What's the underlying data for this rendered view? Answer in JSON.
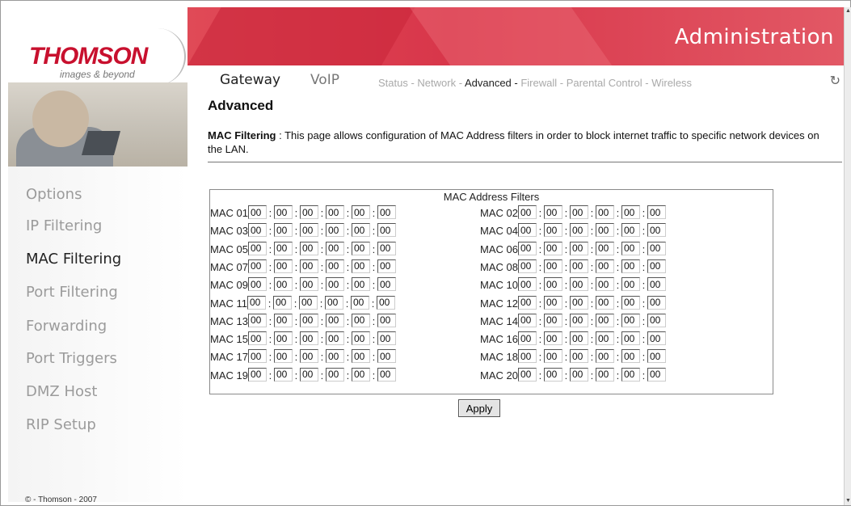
{
  "brand": {
    "name": "THOMSON",
    "tagline": "images & beyond"
  },
  "header": {
    "title": "Administration"
  },
  "tabs": [
    {
      "label": "Gateway",
      "active": true
    },
    {
      "label": "VoIP",
      "active": false
    }
  ],
  "subnav": [
    {
      "label": "Status",
      "active": false
    },
    {
      "label": "Network",
      "active": false
    },
    {
      "label": "Advanced",
      "active": true
    },
    {
      "label": "Firewall",
      "active": false
    },
    {
      "label": "Parental Control",
      "active": false
    },
    {
      "label": "Wireless",
      "active": false
    }
  ],
  "sidebar": {
    "items": [
      {
        "label": "Options",
        "active": false
      },
      {
        "label": "IP Filtering",
        "active": false
      },
      {
        "label": "MAC Filtering",
        "active": true
      },
      {
        "label": "Port Filtering",
        "active": false
      },
      {
        "label": "Forwarding",
        "active": false
      },
      {
        "label": "Port Triggers",
        "active": false
      },
      {
        "label": "DMZ Host",
        "active": false
      },
      {
        "label": "RIP Setup",
        "active": false
      }
    ],
    "copyright": "© - Thomson - 2007"
  },
  "page": {
    "title": "Advanced",
    "desc_strong": "MAC Filtering",
    "desc_text": " :  This page allows configuration of MAC Address filters in order to block internet traffic to specific network devices on the LAN."
  },
  "filters": {
    "caption": "MAC Address Filters",
    "entries": [
      {
        "label": "MAC 01",
        "octets": [
          "00",
          "00",
          "00",
          "00",
          "00",
          "00"
        ]
      },
      {
        "label": "MAC 02",
        "octets": [
          "00",
          "00",
          "00",
          "00",
          "00",
          "00"
        ]
      },
      {
        "label": "MAC 03",
        "octets": [
          "00",
          "00",
          "00",
          "00",
          "00",
          "00"
        ]
      },
      {
        "label": "MAC 04",
        "octets": [
          "00",
          "00",
          "00",
          "00",
          "00",
          "00"
        ]
      },
      {
        "label": "MAC 05",
        "octets": [
          "00",
          "00",
          "00",
          "00",
          "00",
          "00"
        ]
      },
      {
        "label": "MAC 06",
        "octets": [
          "00",
          "00",
          "00",
          "00",
          "00",
          "00"
        ]
      },
      {
        "label": "MAC 07",
        "octets": [
          "00",
          "00",
          "00",
          "00",
          "00",
          "00"
        ]
      },
      {
        "label": "MAC 08",
        "octets": [
          "00",
          "00",
          "00",
          "00",
          "00",
          "00"
        ]
      },
      {
        "label": "MAC 09",
        "octets": [
          "00",
          "00",
          "00",
          "00",
          "00",
          "00"
        ]
      },
      {
        "label": "MAC 10",
        "octets": [
          "00",
          "00",
          "00",
          "00",
          "00",
          "00"
        ]
      },
      {
        "label": "MAC 11",
        "octets": [
          "00",
          "00",
          "00",
          "00",
          "00",
          "00"
        ]
      },
      {
        "label": "MAC 12",
        "octets": [
          "00",
          "00",
          "00",
          "00",
          "00",
          "00"
        ]
      },
      {
        "label": "MAC 13",
        "octets": [
          "00",
          "00",
          "00",
          "00",
          "00",
          "00"
        ]
      },
      {
        "label": "MAC 14",
        "octets": [
          "00",
          "00",
          "00",
          "00",
          "00",
          "00"
        ]
      },
      {
        "label": "MAC 15",
        "octets": [
          "00",
          "00",
          "00",
          "00",
          "00",
          "00"
        ]
      },
      {
        "label": "MAC 16",
        "octets": [
          "00",
          "00",
          "00",
          "00",
          "00",
          "00"
        ]
      },
      {
        "label": "MAC 17",
        "octets": [
          "00",
          "00",
          "00",
          "00",
          "00",
          "00"
        ]
      },
      {
        "label": "MAC 18",
        "octets": [
          "00",
          "00",
          "00",
          "00",
          "00",
          "00"
        ]
      },
      {
        "label": "MAC 19",
        "octets": [
          "00",
          "00",
          "00",
          "00",
          "00",
          "00"
        ]
      },
      {
        "label": "MAC 20",
        "octets": [
          "00",
          "00",
          "00",
          "00",
          "00",
          "00"
        ]
      }
    ],
    "apply_label": "Apply"
  },
  "icons": {
    "refresh": "refresh-icon",
    "scroll_up": "scroll-up-arrow-icon",
    "scroll_down": "scroll-down-arrow-icon"
  },
  "colors": {
    "banner": "#d8364a",
    "brand_red": "#c8102e",
    "inactive_text": "#9b9b9b",
    "active_text": "#222222"
  }
}
